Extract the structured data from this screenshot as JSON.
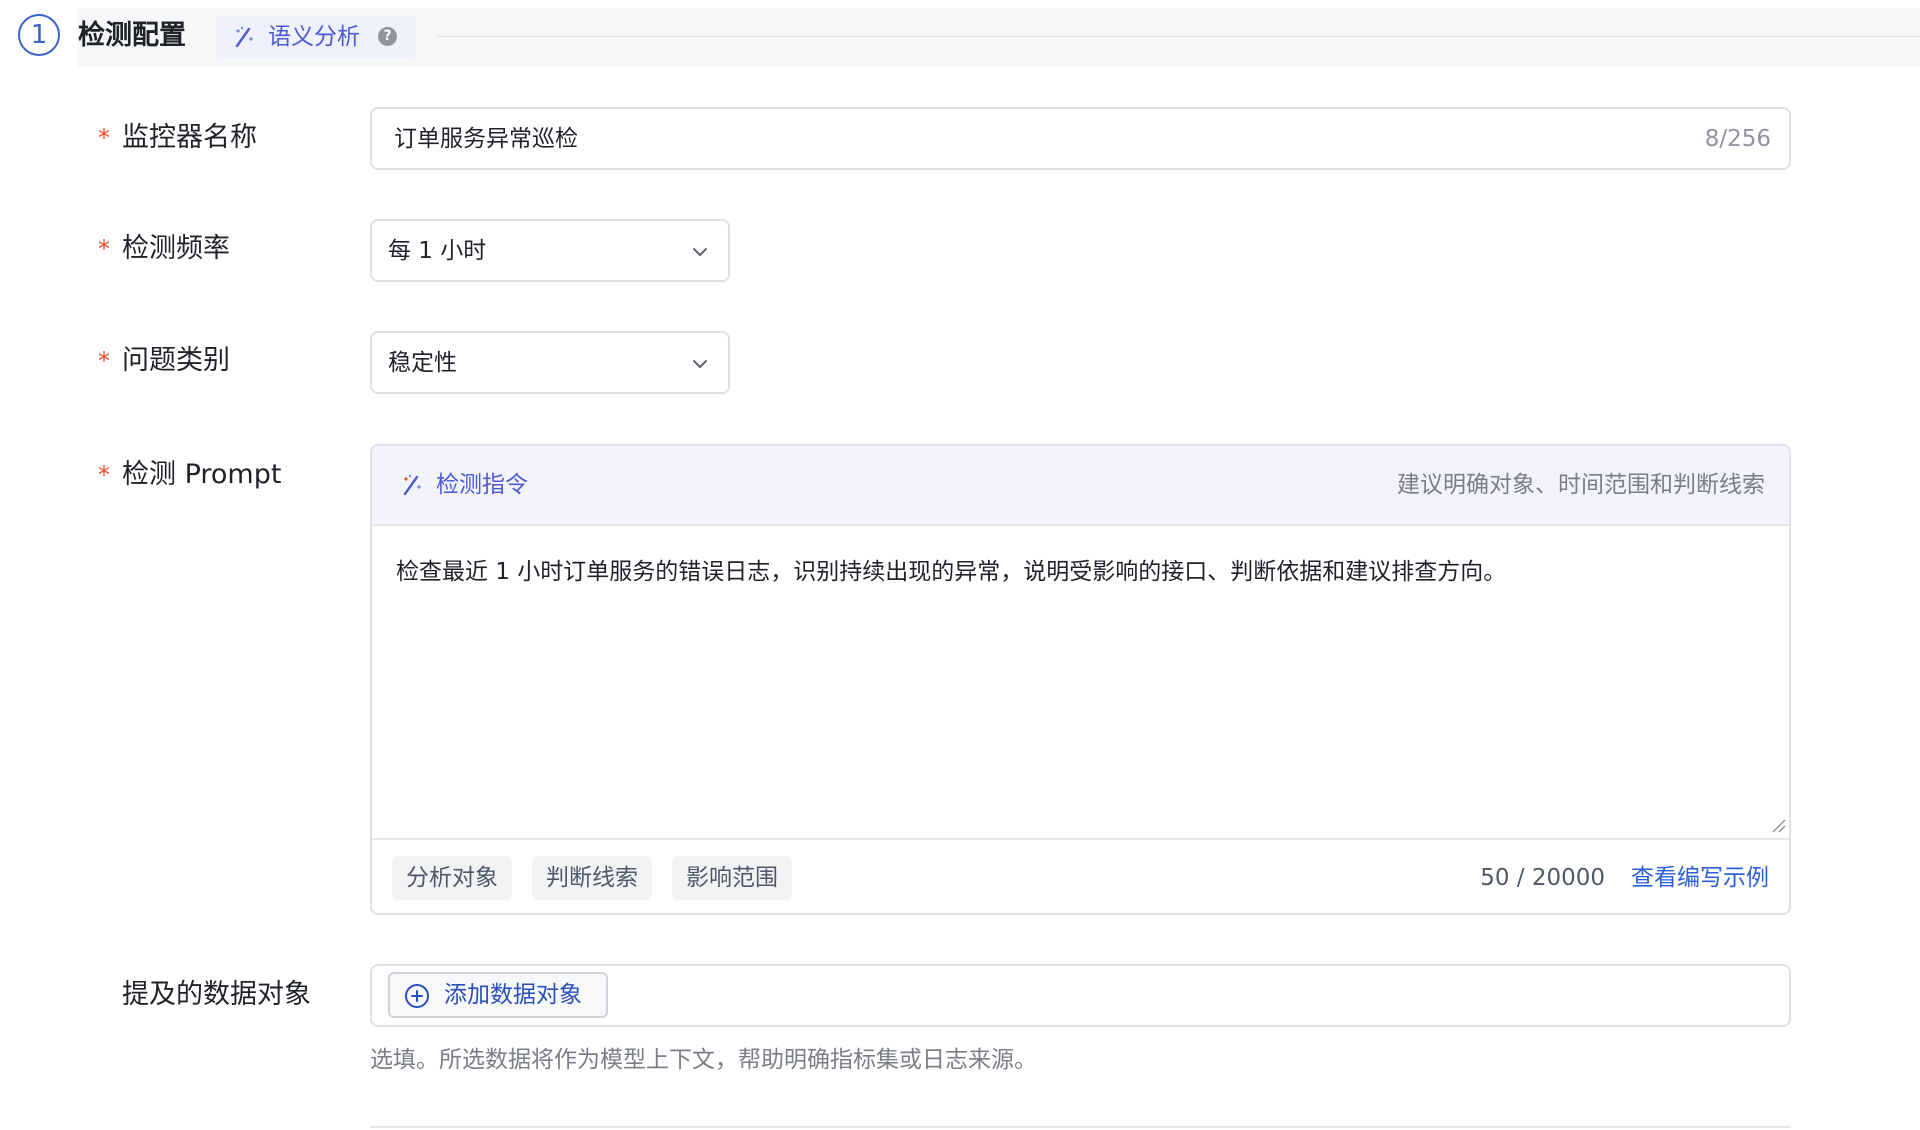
{
  "section": {
    "step": "1",
    "title": "检测配置",
    "chip_label": "语义分析",
    "help_glyph": "?"
  },
  "fields": {
    "required_mark": "*",
    "monitor_name": {
      "label": "监控器名称",
      "value": "订单服务异常巡检",
      "counter": "8/256"
    },
    "frequency": {
      "label": "检测频率",
      "value": "每 1 小时"
    },
    "category": {
      "label": "问题类别",
      "value": "稳定性"
    },
    "prompt": {
      "label": "检测 Prompt",
      "header_title": "检测指令",
      "header_hint": "建议明确对象、时间范围和判断线索",
      "text": "检查最近 1 小时订单服务的错误日志，识别持续出现的异常，说明受影响的接口、判断依据和建议排查方向。",
      "tags": [
        "分析对象",
        "判断线索",
        "影响范围"
      ],
      "counter": "50 / 20000",
      "example_link": "查看编写示例"
    },
    "data_objects": {
      "label": "提及的数据对象",
      "add_button": "添加数据对象",
      "helper": "选填。所选数据将作为模型上下文，帮助明确指标集或日志来源。"
    }
  },
  "icons": {
    "wand": "magic-wand-icon",
    "help": "help-circle-icon",
    "chevron": "chevron-down-icon",
    "plus": "plus-circle-icon",
    "resize": "resize-grip-icon"
  },
  "colors": {
    "accent": "#4d5bd2",
    "link": "#2b5fd9",
    "required": "#e8502b",
    "step": "#3b64c9"
  }
}
